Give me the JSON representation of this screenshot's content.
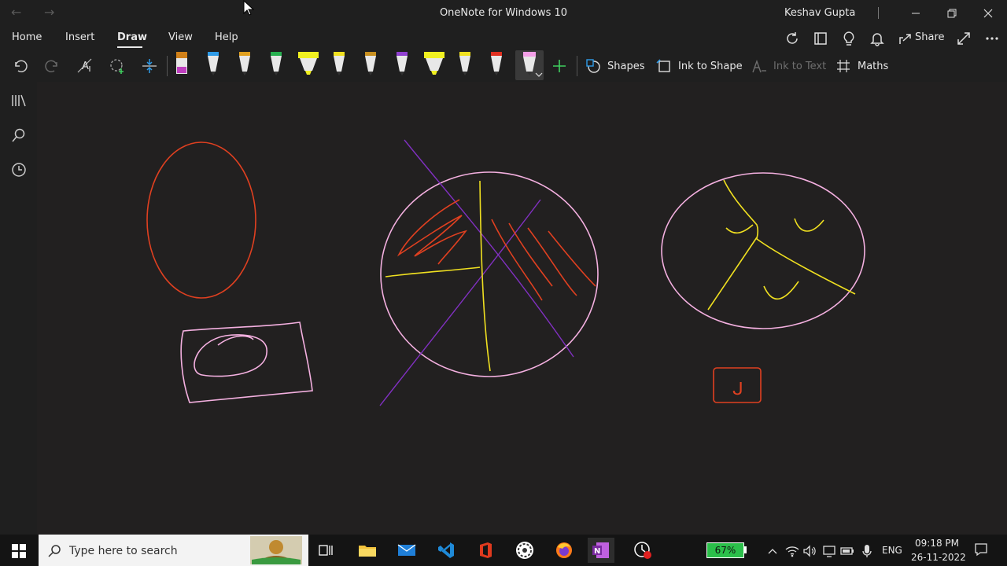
{
  "window": {
    "title": "OneNote for Windows 10",
    "user": "Keshav Gupta",
    "share_label": "Share"
  },
  "ribbon": {
    "tabs": [
      {
        "label": "Home"
      },
      {
        "label": "Insert"
      },
      {
        "label": "Draw",
        "active": true
      },
      {
        "label": "View"
      },
      {
        "label": "Help"
      }
    ]
  },
  "toolbar": {
    "shapes_label": "Shapes",
    "ink_to_shape_label": "Ink to Shape",
    "ink_to_text_label": "Ink to Text",
    "maths_label": "Maths",
    "pens": [
      {
        "kind": "marker",
        "color": "#c040c0"
      },
      {
        "kind": "pen",
        "color": "#2e9be8"
      },
      {
        "kind": "pen",
        "color": "#e0a020"
      },
      {
        "kind": "pen",
        "color": "#28b050"
      },
      {
        "kind": "highlighter",
        "color": "#f0f020"
      },
      {
        "kind": "pen",
        "color": "#f0e020"
      },
      {
        "kind": "pen",
        "color": "#c89020"
      },
      {
        "kind": "pen",
        "color": "#9040d0"
      },
      {
        "kind": "highlighter",
        "color": "#f0f020"
      },
      {
        "kind": "pen",
        "color": "#f0e020"
      },
      {
        "kind": "pen",
        "color": "#e03020"
      },
      {
        "kind": "pen",
        "color": "#f4a0e8",
        "selected": true
      }
    ]
  },
  "canvas": {
    "annotation": "ᒍ"
  },
  "taskbar": {
    "search_placeholder": "Type here to search",
    "battery": "67%",
    "language": "ENG",
    "time": "09:18 PM",
    "date": "26-11-2022"
  }
}
